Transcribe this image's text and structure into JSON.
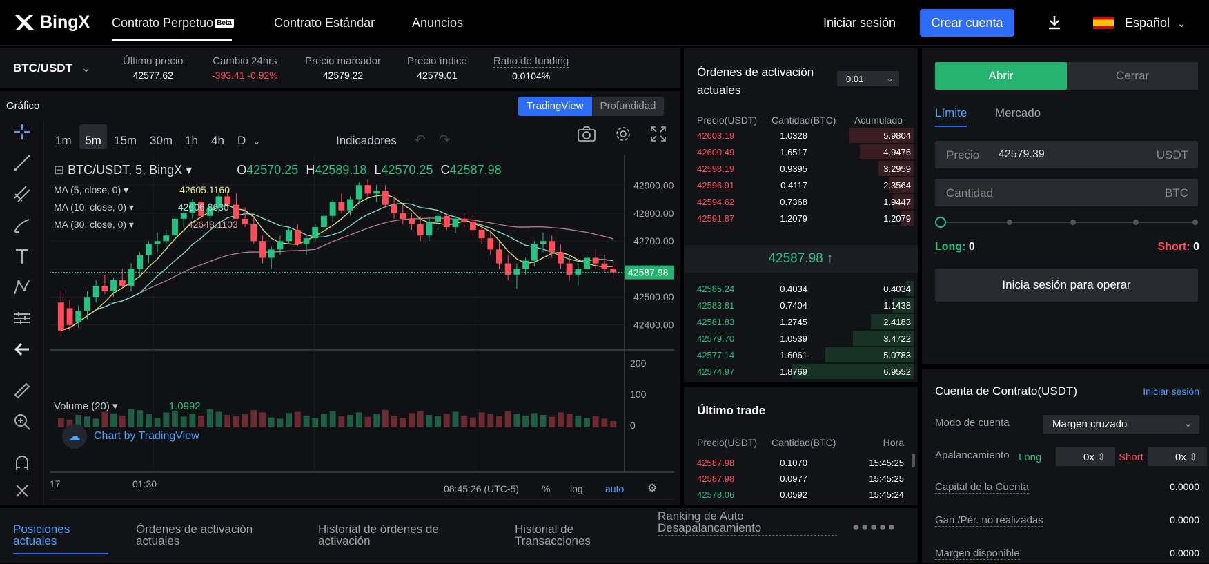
{
  "header": {
    "logo": "BingX",
    "nav": [
      "Contrato Perpetuo",
      "Contrato Estándar",
      "Anuncios"
    ],
    "beta": "Beta",
    "login": "Iniciar sesión",
    "create": "Crear cuenta",
    "lang": "Español"
  },
  "ticker": {
    "pair": "BTC/USDT",
    "items": [
      {
        "label": "Último precio",
        "value": "42577.62"
      },
      {
        "label": "Cambio 24hrs",
        "value": "-393.41  -0.92%"
      },
      {
        "label": "Precio marcador",
        "value": "42579.22"
      },
      {
        "label": "Precio índice",
        "value": "42579.01"
      },
      {
        "label": "Ratio de funding",
        "value": "0.0104%"
      }
    ]
  },
  "chart": {
    "title": "Gráfico",
    "tab_tv": "TradingView",
    "tab_depth": "Profundidad",
    "timeframes": [
      "1m",
      "5m",
      "15m",
      "30m",
      "1h",
      "4h",
      "D"
    ],
    "active_tf": "5m",
    "indicators": "Indicadores",
    "symbol": "BTC/USDT, 5, BingX",
    "o_lbl": "O",
    "o": "42570.25",
    "h_lbl": "H",
    "h": "42589.18",
    "l_lbl": "L",
    "l": "42570.25",
    "c_lbl": "C",
    "c": "42587.98",
    "ma5": "MA (5, close, 0)",
    "ma5v": "42605.1160",
    "ma10": "MA (10, close, 0)",
    "ma10v": "42606.8630",
    "ma30": "MA (30, close, 0)",
    "ma30v": "42648.1103",
    "vol": "Volume (20)",
    "volv": "1.0992",
    "watermark": "Chart by TradingView",
    "y_ticks": [
      "42900.00",
      "42800.00",
      "42700.00",
      "42600.00",
      "42500.00",
      "42400.00"
    ],
    "price_tag": "42587.98",
    "vol_ticks": [
      "200",
      "100",
      "0"
    ],
    "x_ticks": [
      "17",
      "01:30"
    ],
    "time": "08:45:26",
    "tz": "(UTC-5)",
    "pct": "%",
    "log": "log",
    "auto": "auto"
  },
  "chart_data": {
    "type": "candlestick",
    "ylim": [
      42330,
      42960
    ],
    "last": 42587.98,
    "candles": [
      [
        42480,
        42520,
        42360,
        42380
      ],
      [
        42460,
        42490,
        42380,
        42400
      ],
      [
        42410,
        42470,
        42390,
        42450
      ],
      [
        42450,
        42520,
        42420,
        42500
      ],
      [
        42500,
        42560,
        42480,
        42540
      ],
      [
        42540,
        42580,
        42510,
        42520
      ],
      [
        42520,
        42570,
        42500,
        42560
      ],
      [
        42560,
        42600,
        42530,
        42540
      ],
      [
        42540,
        42620,
        42520,
        42600
      ],
      [
        42600,
        42660,
        42580,
        42650
      ],
      [
        42650,
        42700,
        42620,
        42690
      ],
      [
        42690,
        42730,
        42660,
        42700
      ],
      [
        42700,
        42740,
        42680,
        42720
      ],
      [
        42720,
        42790,
        42700,
        42780
      ],
      [
        42780,
        42820,
        42750,
        42800
      ],
      [
        42800,
        42850,
        42780,
        42840
      ],
      [
        42840,
        42860,
        42770,
        42790
      ],
      [
        42790,
        42840,
        42760,
        42820
      ],
      [
        42820,
        42870,
        42800,
        42860
      ],
      [
        42860,
        42880,
        42820,
        42830
      ],
      [
        42830,
        42870,
        42800,
        42780
      ],
      [
        42780,
        42820,
        42750,
        42760
      ],
      [
        42760,
        42790,
        42690,
        42700
      ],
      [
        42700,
        42720,
        42620,
        42640
      ],
      [
        42640,
        42680,
        42600,
        42670
      ],
      [
        42670,
        42720,
        42650,
        42700
      ],
      [
        42700,
        42750,
        42690,
        42740
      ],
      [
        42740,
        42760,
        42680,
        42690
      ],
      [
        42690,
        42720,
        42650,
        42710
      ],
      [
        42710,
        42760,
        42700,
        42750
      ],
      [
        42750,
        42800,
        42730,
        42790
      ],
      [
        42790,
        42850,
        42770,
        42840
      ],
      [
        42840,
        42870,
        42800,
        42810
      ],
      [
        42810,
        42860,
        42790,
        42850
      ],
      [
        42850,
        42910,
        42830,
        42900
      ],
      [
        42900,
        42920,
        42860,
        42870
      ],
      [
        42870,
        42900,
        42840,
        42880
      ],
      [
        42880,
        42900,
        42820,
        42830
      ],
      [
        42830,
        42860,
        42780,
        42800
      ],
      [
        42800,
        42830,
        42760,
        42780
      ],
      [
        42780,
        42800,
        42740,
        42760
      ],
      [
        42760,
        42790,
        42700,
        42720
      ],
      [
        42720,
        42780,
        42700,
        42770
      ],
      [
        42770,
        42800,
        42740,
        42790
      ],
      [
        42790,
        42800,
        42740,
        42750
      ],
      [
        42750,
        42790,
        42730,
        42780
      ],
      [
        42780,
        42800,
        42750,
        42770
      ],
      [
        42770,
        42790,
        42720,
        42740
      ],
      [
        42740,
        42760,
        42690,
        42710
      ],
      [
        42710,
        42740,
        42650,
        42670
      ],
      [
        42670,
        42700,
        42600,
        42620
      ],
      [
        42620,
        42650,
        42560,
        42580
      ],
      [
        42580,
        42620,
        42530,
        42600
      ],
      [
        42600,
        42640,
        42580,
        42630
      ],
      [
        42630,
        42700,
        42610,
        42690
      ],
      [
        42690,
        42730,
        42660,
        42700
      ],
      [
        42700,
        42720,
        42640,
        42660
      ],
      [
        42660,
        42690,
        42600,
        42620
      ],
      [
        42620,
        42650,
        42560,
        42580
      ],
      [
        42580,
        42620,
        42540,
        42600
      ],
      [
        42600,
        42660,
        42580,
        42640
      ],
      [
        42640,
        42670,
        42600,
        42620
      ],
      [
        42620,
        42650,
        42590,
        42600
      ],
      [
        42600,
        42630,
        42570,
        42588
      ]
    ],
    "volumes": [
      30,
      25,
      40,
      35,
      28,
      50,
      45,
      38,
      60,
      55,
      42,
      30,
      48,
      52,
      35,
      44,
      38,
      58,
      50,
      40,
      36,
      42,
      55,
      48,
      32,
      28,
      46,
      50,
      38,
      30,
      44,
      52,
      36,
      40,
      48,
      34,
      42,
      56,
      38,
      30,
      46,
      52,
      40,
      36,
      44,
      50,
      38,
      32,
      48,
      42,
      36,
      52,
      44,
      38,
      46,
      40,
      34,
      48,
      42,
      38,
      30,
      36,
      28,
      20
    ]
  },
  "orderbook": {
    "title": "Órdenes de activación actuales",
    "precision": "0.01",
    "cols": [
      "Precio(USDT)",
      "Cantidad(BTC)",
      "Acumulado"
    ],
    "asks": [
      [
        "42603.19",
        "1.0328",
        "5.9804"
      ],
      [
        "42600.49",
        "1.6517",
        "4.9476"
      ],
      [
        "42598.19",
        "0.9395",
        "3.2959"
      ],
      [
        "42596.91",
        "0.4117",
        "2.3564"
      ],
      [
        "42594.62",
        "0.7368",
        "1.9447"
      ],
      [
        "42591.87",
        "1.2079",
        "1.2079"
      ]
    ],
    "ask_depth": [
      0.31,
      0.26,
      0.17,
      0.12,
      0.1,
      0.06
    ],
    "mid": "42587.98 ↑",
    "bids": [
      [
        "42585.24",
        "0.4034",
        "0.4034"
      ],
      [
        "42583.81",
        "0.7404",
        "1.1438"
      ],
      [
        "42581.83",
        "1.2745",
        "2.4183"
      ],
      [
        "42579.70",
        "1.0539",
        "3.4722"
      ],
      [
        "42577.14",
        "1.6061",
        "5.0783"
      ],
      [
        "42574.97",
        "1.8769",
        "6.9552"
      ]
    ],
    "bid_depth": [
      0.06,
      0.17,
      0.35,
      0.5,
      0.73,
      1.0
    ]
  },
  "trades": {
    "title": "Último trade",
    "cols": [
      "Precio(USDT)",
      "Cantidad(BTC)",
      "Hora"
    ],
    "rows": [
      [
        "42587.98",
        "0.1070",
        "15:45:25"
      ],
      [
        "42587.98",
        "0.0977",
        "15:45:25"
      ],
      [
        "42578.06",
        "0.0592",
        "15:45:24"
      ]
    ]
  },
  "trade": {
    "open": "Abrir",
    "close": "Cerrar",
    "limit": "Límite",
    "market": "Mercado",
    "price_lbl": "Precio",
    "price_val": "42579.39",
    "usdt": "USDT",
    "qty": "Cantidad",
    "btc": "BTC",
    "long": "Long:",
    "long_v": "0",
    "short": "Short:",
    "short_v": "0",
    "login_btn": "Inicia sesión para operar"
  },
  "account": {
    "title": "Cuenta de Contrato(USDT)",
    "login": "Iniciar sesión",
    "mode_lbl": "Modo de cuenta",
    "mode": "Margen cruzado",
    "lev_lbl": "Apalancamiento",
    "long": "Long",
    "short": "Short",
    "lev_val": "0",
    "x": "x",
    "rows": [
      [
        "Capital de la Cuenta",
        "0.0000"
      ],
      [
        "Gan./Pér. no realizadas",
        "0.0000"
      ],
      [
        "Margen disponible",
        "0.0000"
      ]
    ]
  },
  "bottom": {
    "tabs": [
      "Posiciones actuales",
      "Órdenes de activación actuales",
      "Historial de órdenes de activación",
      "Historial de Transacciones",
      "Ranking de Auto Desapalancamiento"
    ]
  }
}
